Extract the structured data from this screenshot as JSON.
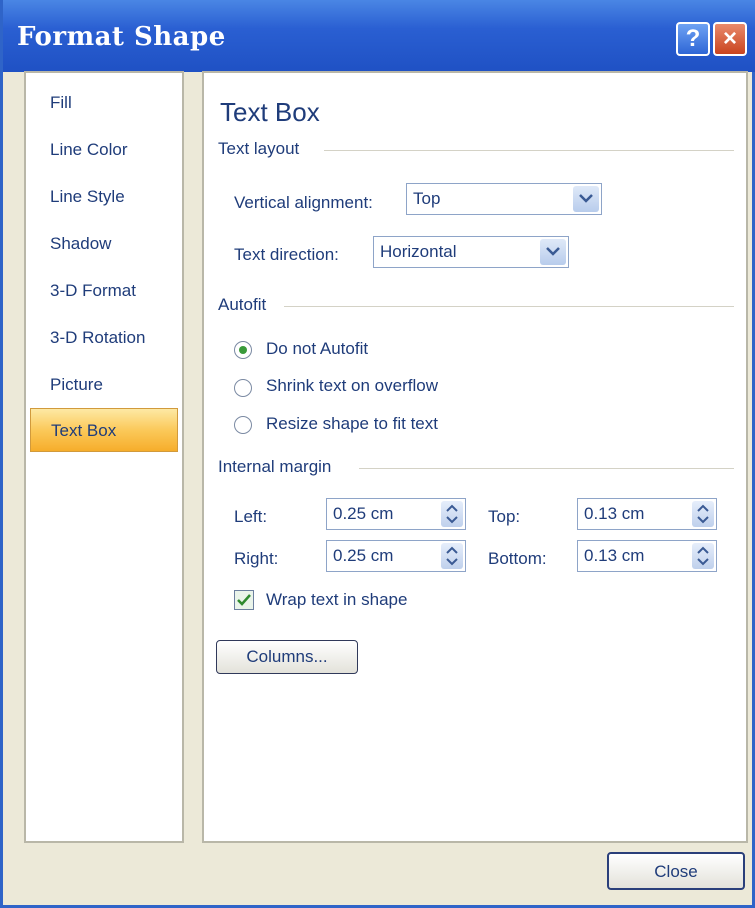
{
  "window": {
    "title": "Format Shape",
    "help_glyph": "?",
    "close_glyph": "×"
  },
  "sidebar": {
    "items": [
      {
        "label": "Fill"
      },
      {
        "label": "Line Color"
      },
      {
        "label": "Line Style"
      },
      {
        "label": "Shadow"
      },
      {
        "label": "3-D Format"
      },
      {
        "label": "3-D Rotation"
      },
      {
        "label": "Picture"
      },
      {
        "label": "Text Box"
      }
    ],
    "selected": "Text Box"
  },
  "panel": {
    "title": "Text Box",
    "text_layout": {
      "heading": "Text layout",
      "vertical_alignment_label": "Vertical alignment:",
      "vertical_alignment_value": "Top",
      "text_direction_label": "Text direction:",
      "text_direction_value": "Horizontal"
    },
    "autofit": {
      "heading": "Autofit",
      "options": [
        {
          "label": "Do not Autofit",
          "checked": true
        },
        {
          "label": "Shrink text on overflow",
          "checked": false
        },
        {
          "label": "Resize shape to fit text",
          "checked": false
        }
      ]
    },
    "internal_margin": {
      "heading": "Internal margin",
      "left_label": "Left:",
      "left_value": "0.25 cm",
      "top_label": "Top:",
      "top_value": "0.13 cm",
      "right_label": "Right:",
      "right_value": "0.25 cm",
      "bottom_label": "Bottom:",
      "bottom_value": "0.13 cm"
    },
    "wrap_text": {
      "label": "Wrap text in shape",
      "checked": true
    },
    "columns_button": "Columns..."
  },
  "footer": {
    "close_button": "Close"
  },
  "colors": {
    "title_bar": "#2a5fd2",
    "selected_nav": "#fbc95a",
    "text": "#1f3c7a"
  }
}
